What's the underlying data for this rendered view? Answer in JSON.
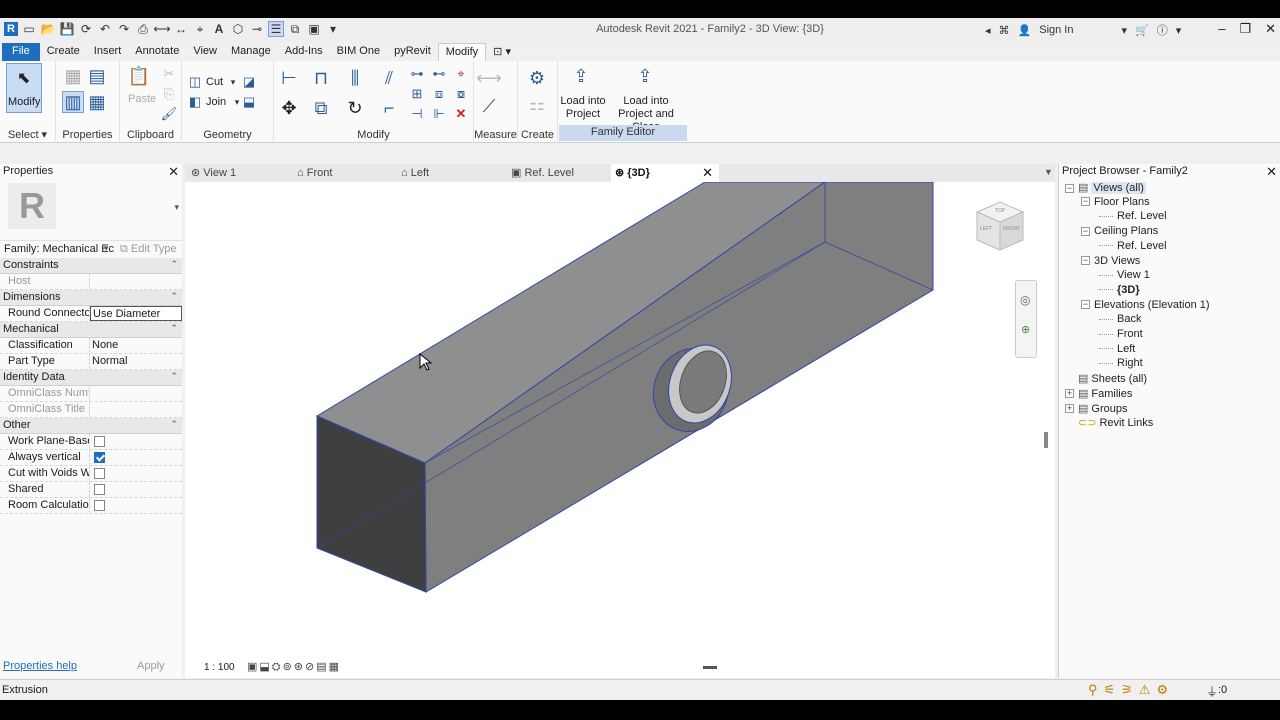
{
  "app_title": "Autodesk Revit 2021 - Family2 - 3D View: {3D}",
  "sign_in": "Sign In",
  "tabs": [
    "File",
    "Create",
    "Insert",
    "Annotate",
    "View",
    "Manage",
    "Add-Ins",
    "BIM One",
    "pyRevit",
    "Modify"
  ],
  "ribbon": {
    "modify_label": "Modify",
    "select_label": "Select",
    "properties_label": "Properties",
    "paste_label": "Paste",
    "clipboard_label": "Clipboard",
    "cut_label": "Cut",
    "join_label": "Join",
    "geometry_label": "Geometry",
    "modify_panel_label": "Modify",
    "measure_label": "Measure",
    "create_label": "Create",
    "load_into_project": "Load into\nProject",
    "load_into_project_close": "Load into\nProject and Close",
    "family_editor_label": "Family Editor"
  },
  "properties": {
    "title": "Properties",
    "type_selector": "Family: Mechanical Ec",
    "edit_type": "Edit Type",
    "sections": [
      {
        "name": "Constraints",
        "rows": [
          {
            "k": "Host",
            "v": "",
            "gray": true
          }
        ]
      },
      {
        "name": "Dimensions",
        "rows": [
          {
            "k": "Round Connector...",
            "v": "Use Diameter"
          }
        ]
      },
      {
        "name": "Mechanical",
        "rows": [
          {
            "k": "Classification",
            "v": "None"
          },
          {
            "k": "Part Type",
            "v": "Normal"
          }
        ]
      },
      {
        "name": "Identity Data",
        "rows": [
          {
            "k": "OmniClass Numb...",
            "v": "",
            "gray": true
          },
          {
            "k": "OmniClass Title",
            "v": "",
            "gray": true
          }
        ]
      },
      {
        "name": "Other",
        "rows": [
          {
            "k": "Work Plane-Based",
            "check": false
          },
          {
            "k": "Always vertical",
            "check": true
          },
          {
            "k": "Cut with Voids W...",
            "check": false
          },
          {
            "k": "Shared",
            "check": false
          },
          {
            "k": "Room Calculatio...",
            "check": false
          }
        ]
      }
    ],
    "help": "Properties help",
    "apply": "Apply"
  },
  "view_tabs": [
    "View 1",
    "Front",
    "Left",
    "Ref. Level",
    "{3D}"
  ],
  "scale": "1 : 100",
  "project_browser": {
    "title": "Project Browser - Family2",
    "items": [
      {
        "label": "Views (all)",
        "level": 0,
        "toggle": "−",
        "icon": true,
        "highlight": true
      },
      {
        "label": "Floor Plans",
        "level": 1,
        "toggle": "−"
      },
      {
        "label": "Ref. Level",
        "level": 2
      },
      {
        "label": "Ceiling Plans",
        "level": 1,
        "toggle": "−"
      },
      {
        "label": "Ref. Level",
        "level": 2
      },
      {
        "label": "3D Views",
        "level": 1,
        "toggle": "−"
      },
      {
        "label": "View 1",
        "level": 2
      },
      {
        "label": "{3D}",
        "level": 2,
        "bold": true
      },
      {
        "label": "Elevations (Elevation 1)",
        "level": 1,
        "toggle": "−"
      },
      {
        "label": "Back",
        "level": 2
      },
      {
        "label": "Front",
        "level": 2
      },
      {
        "label": "Left",
        "level": 2
      },
      {
        "label": "Right",
        "level": 2
      },
      {
        "label": "Sheets (all)",
        "level": 0,
        "icon": true
      },
      {
        "label": "Families",
        "level": 0,
        "toggle": "+",
        "icon": true
      },
      {
        "label": "Groups",
        "level": 0,
        "toggle": "+",
        "icon": true
      },
      {
        "label": "Revit Links",
        "level": 0,
        "link": true
      }
    ]
  },
  "status": "Extrusion",
  "status_filter_count": ":0",
  "viewcube": {
    "left": "LEFT",
    "front": "FRONT",
    "top": "TOP"
  }
}
